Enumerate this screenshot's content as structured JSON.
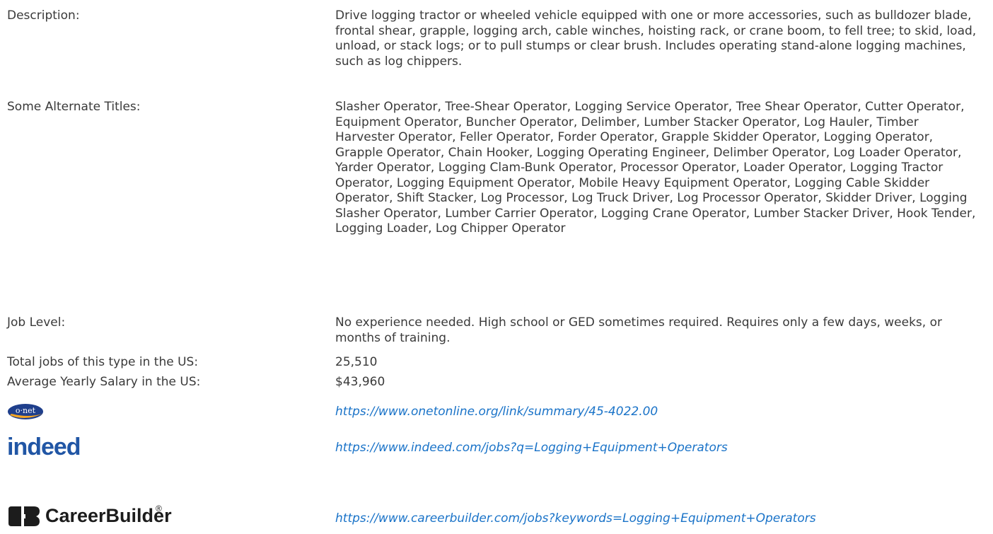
{
  "rows": {
    "description": {
      "label": "Description:",
      "value": "Drive logging tractor or wheeled vehicle equipped with one or more accessories, such as bulldozer blade, frontal shear, grapple, logging arch, cable winches, hoisting rack, or crane boom, to fell tree; to skid, load, unload, or stack logs; or to pull stumps or clear brush. Includes operating stand-alone logging machines, such as log chippers."
    },
    "alternate_titles": {
      "label": "Some Alternate Titles:",
      "value": "Slasher Operator, Tree-Shear Operator, Logging Service Operator, Tree Shear Operator, Cutter Operator, Equipment Operator, Buncher Operator, Delimber, Lumber Stacker Operator, Log Hauler, Timber Harvester Operator, Feller Operator, Forder Operator, Grapple Skidder Operator, Logging Operator, Grapple Operator, Chain Hooker, Logging Operating Engineer, Delimber Operator, Log Loader Operator, Yarder Operator, Logging Clam-Bunk Operator, Processor Operator, Loader Operator, Logging Tractor Operator, Logging Equipment Operator, Mobile Heavy Equipment Operator, Logging Cable Skidder Operator, Shift Stacker, Log Processor, Log Truck Driver, Log Processor Operator, Skidder Driver, Logging Slasher Operator, Lumber Carrier Operator, Logging Crane Operator, Lumber Stacker Driver, Hook Tender, Logging Loader, Log Chipper Operator"
    },
    "job_level": {
      "label": "Job Level:",
      "value": "No experience needed. High school or GED sometimes required. Requires only a few days, weeks, or months of training."
    },
    "total_jobs": {
      "label": "Total jobs of this type in the US:",
      "value": "25,510"
    },
    "salary": {
      "label": "Average Yearly Salary in the US:",
      "value": "$43,960"
    }
  },
  "links": {
    "onet": {
      "logo_text": "o·net",
      "url": "https://www.onetonline.org/link/summary/45-4022.00"
    },
    "indeed": {
      "logo_text": "indeed",
      "url": "https://www.indeed.com/jobs?q=Logging+Equipment+Operators"
    },
    "careerbuilder": {
      "logo_text": "CareerBuilder",
      "logo_mark": "®",
      "url": "https://www.careerbuilder.com/jobs?keywords=Logging+Equipment+Operators"
    }
  },
  "colors": {
    "text": "#3a3a3a",
    "link": "#1a73c8",
    "indeed_blue": "#2156a5",
    "onet_blue": "#1f3f8c",
    "onet_orange": "#f5a623"
  }
}
